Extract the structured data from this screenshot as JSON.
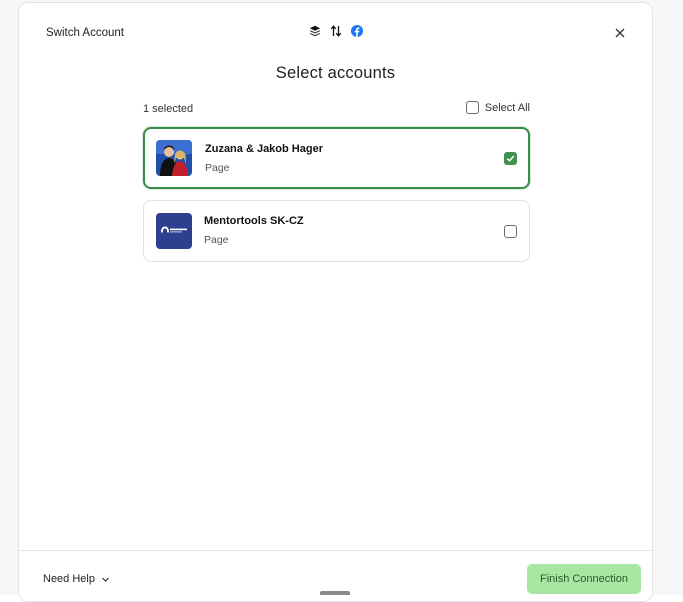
{
  "header": {
    "title": "Switch Account",
    "icons": [
      "buffer-stack-icon",
      "arrows-updown-icon",
      "facebook-icon"
    ],
    "close_icon": "close-icon"
  },
  "heading": "Select accounts",
  "toolbar": {
    "selected_count": "1 selected",
    "select_all_label": "Select All",
    "select_all_checked": false
  },
  "accounts": [
    {
      "name": "Zuzana & Jakob Hager",
      "type": "Page",
      "selected": true
    },
    {
      "name": "Mentortools SK-CZ",
      "type": "Page",
      "selected": false
    }
  ],
  "footer": {
    "need_help_label": "Need Help",
    "finish_label": "Finish Connection"
  },
  "colors": {
    "accent_green": "#3b8c48",
    "finish_button_bg": "#a8e6a3",
    "facebook_blue": "#1877f2",
    "mentortools_navy": "#2f3f8f"
  }
}
